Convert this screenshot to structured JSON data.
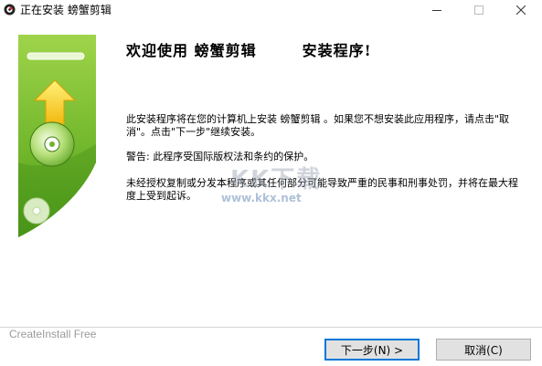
{
  "window": {
    "title": "正在安装 螃蟹剪辑",
    "app_icon": "crab-app-icon",
    "controls": {
      "minimize": "—",
      "maximize": "☐",
      "close": "✕"
    }
  },
  "content": {
    "heading_part1": "欢迎使用 螃蟹剪辑",
    "heading_part2": "安装程序!",
    "paragraph1": "此安装程序将在您的计算机上安装 螃蟹剪辑 。如果您不想安装此应用程序，请点击\"取消\"。点击\"下一步\"继续安装。",
    "paragraph2": "警告: 此程序受国际版权法和条约的保护。",
    "paragraph3": "未经授权复制或分发本程序或其任何部分可能导致严重的民事和刑事处罚，并将在最大程度上受到起诉。"
  },
  "watermark": {
    "text": "KK下载",
    "url": "www.kkx.net"
  },
  "footer": {
    "brand": "CreateInstall Free",
    "next_label": "下一步(N) >",
    "cancel_label": "取消(C)"
  },
  "colors": {
    "graphic_green": "#7dbf2a",
    "graphic_dark_green": "#4f9a1c",
    "arrow_yellow": "#ffd21e",
    "focus_blue": "#0078d7"
  }
}
